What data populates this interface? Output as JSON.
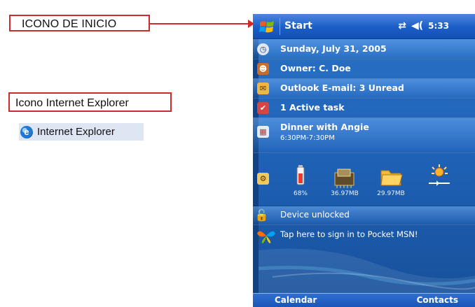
{
  "annotations": {
    "start_icon_label": "ICONO DE INICIO",
    "ie_icon_label": "Icono Internet Explorer",
    "ie_sample_label": "Internet Explorer"
  },
  "device": {
    "title": "Start",
    "clock": "5:33",
    "today": {
      "date": "Sunday, July 31, 2005",
      "owner": "Owner: C. Doe",
      "mail": "Outlook E-mail: 3 Unread",
      "tasks": "1 Active task",
      "appointment": "Dinner with Angie",
      "appointment_time": "6:30PM-7:30PM",
      "battery": "68%",
      "memory": "36.97MB",
      "storage": "29.97MB",
      "lock_status": "Device unlocked",
      "msn_prompt": "Tap here to sign in to Pocket MSN!"
    },
    "softkeys": {
      "left": "Calendar",
      "right": "Contacts"
    }
  },
  "colors": {
    "annotation_red": "#d12a2a",
    "title_blue": "#1b5dc7",
    "background_blue": "#1f63b8"
  }
}
